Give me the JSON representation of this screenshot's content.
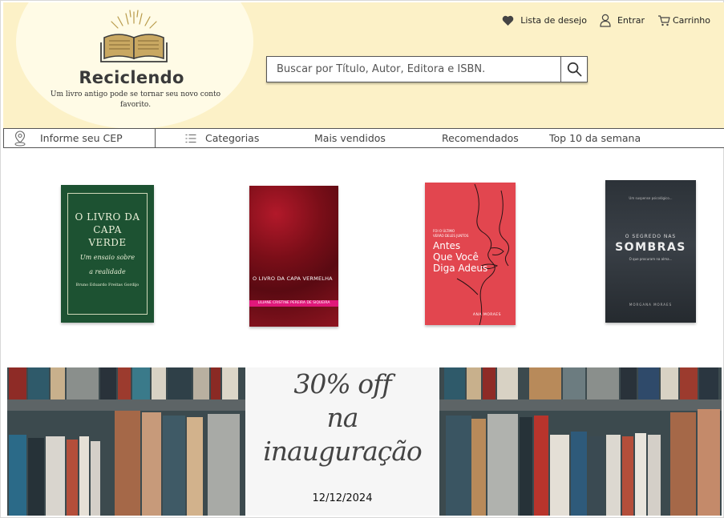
{
  "brand": {
    "name": "Reciclendo",
    "tagline": "Um livro antigo pode se tornar seu novo conto favorito."
  },
  "top_links": {
    "wishlist": "Lista de desejo",
    "login": "Entrar",
    "cart": "Carrinho"
  },
  "search": {
    "placeholder": "Buscar por Título, Autor, Editora e ISBN."
  },
  "nav": {
    "cep": "Informe seu CEP",
    "categories": "Categorias",
    "best_sellers": "Mais vendidos",
    "recommended": "Recomendados",
    "top10": "Top 10 da semana"
  },
  "books": [
    {
      "title_lines": [
        "O LIVRO DA",
        "CAPA",
        "VERDE"
      ],
      "subtitle_lines": [
        "Um ensaio sobre",
        "a realidade"
      ],
      "author": "Bruno Eduardo Freitas Gordijo",
      "color": "#1d5232"
    },
    {
      "title": "O LIVRO DA CAPA VERMELHA",
      "author": "LILIANE CRISTINE PEREIRA DE SIQUEIRA",
      "color": "#7a0e18"
    },
    {
      "tagline_lines": [
        "FOI O ÚLTIMO",
        "VERÃO DELES JUNTOS"
      ],
      "title_lines": [
        "Antes",
        "Que Você",
        "Diga Adeus"
      ],
      "author": "ANA MORAES",
      "color": "#e2464f"
    },
    {
      "top": "Um suspense psicológico...",
      "title_small": "O SEGREDO NAS",
      "title_big": "SOMBRAS",
      "subtitle": "O que procuram na alma...",
      "author": "MORGANA MORAES",
      "color": "#2c3238"
    }
  ],
  "banner": {
    "promo_lines": [
      "30% off",
      "na",
      "inauguração"
    ],
    "date": "12/12/2024"
  },
  "colors": {
    "header_bg": "#fcf1c7",
    "logo_circle": "#fffbe6",
    "nav_text": "#444444"
  }
}
